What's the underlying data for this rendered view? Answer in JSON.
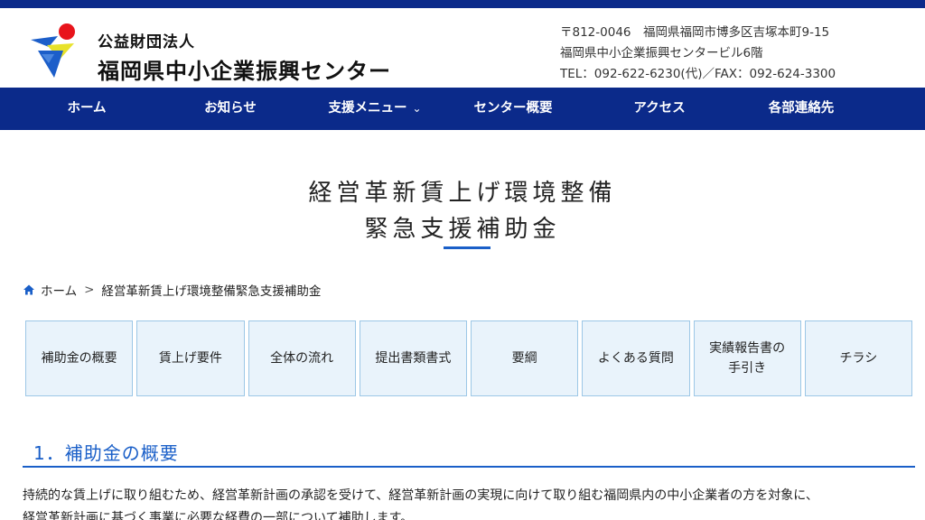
{
  "header": {
    "org_sub": "公益財団法人",
    "org_name": "福岡県中小企業振興センター",
    "address_line1": "〒812-0046　福岡県福岡市博多区吉塚本町9-15",
    "address_line2": "福岡県中小企業振興センタービル6階",
    "tel_fax": "TEL：092-622-6230(代)／FAX：092-624-3300"
  },
  "nav": {
    "items": [
      {
        "label": "ホーム"
      },
      {
        "label": "お知らせ"
      },
      {
        "label": "支援メニュー",
        "has_dropdown": true
      },
      {
        "label": "センター概要"
      },
      {
        "label": "アクセス"
      },
      {
        "label": "各部連絡先"
      }
    ]
  },
  "page": {
    "title_line1": "経営革新賃上げ環境整備",
    "title_line2": "緊急支援補助金"
  },
  "breadcrumb": {
    "home": "ホーム",
    "separator": ">",
    "current": "経営革新賃上げ環境整備緊急支援補助金"
  },
  "subnav": {
    "items": [
      {
        "label": "補助金の概要"
      },
      {
        "label": "賃上げ要件"
      },
      {
        "label": "全体の流れ"
      },
      {
        "label": "提出書類書式"
      },
      {
        "label": "要綱"
      },
      {
        "label": "よくある質問"
      },
      {
        "label": "実績報告書の\n手引き"
      },
      {
        "label": "チラシ"
      }
    ]
  },
  "section": {
    "heading": "1．補助金の概要",
    "body_line1": "持続的な賃上げに取り組むため、経営革新計画の承認を受けて、経営革新計画の実現に向けて取り組む福岡県内の中小企業者の方を対象に、",
    "body_line2": "経営革新計画に基づく事業に必要な経費の一部について補助します。"
  },
  "colors": {
    "brand_navy": "#0b2a8a",
    "accent_blue": "#1a5fc8",
    "tab_bg": "#e9f3fb",
    "tab_border": "#9cc7e6"
  },
  "icons": {
    "breadcrumb_home": "home-icon",
    "dropdown": "chevron-down-icon"
  }
}
